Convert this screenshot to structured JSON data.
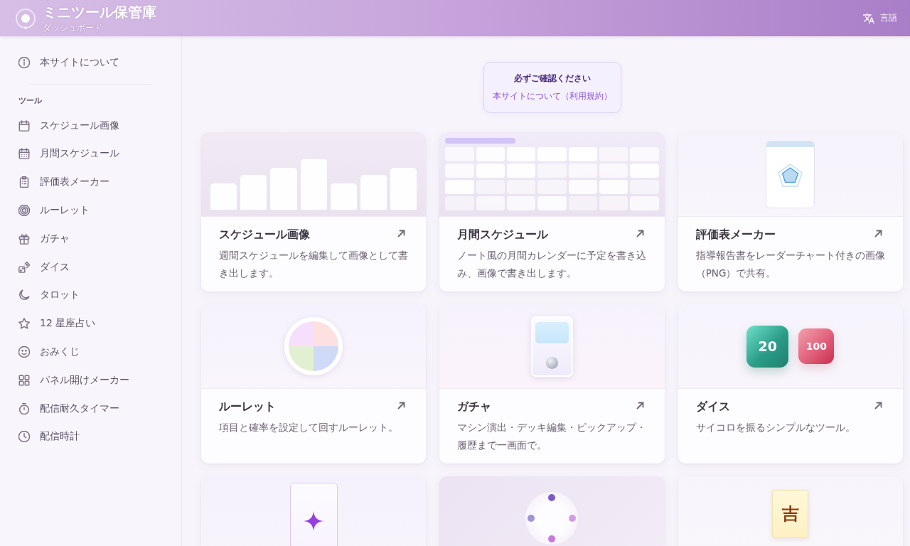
{
  "header": {
    "title": "ミニツール保管庫",
    "subtitle": "ダッシュボード",
    "language_button": "言語"
  },
  "sidebar": {
    "about_item": {
      "kind": "info",
      "label": "本サイトについて",
      "selected": false
    },
    "section_label": "ツール",
    "items": [
      {
        "kind": "calendar",
        "label": "スケジュール画像",
        "selected": false
      },
      {
        "kind": "calendar-grid",
        "label": "月間スケジュール",
        "selected": false
      },
      {
        "kind": "clipboard",
        "label": "評価表メーカー",
        "selected": false
      },
      {
        "kind": "target",
        "label": "ルーレット",
        "selected": false
      },
      {
        "kind": "gift",
        "label": "ガチャ",
        "selected": false
      },
      {
        "kind": "dice",
        "label": "ダイス",
        "selected": false
      },
      {
        "kind": "moon",
        "label": "タロット",
        "selected": false
      },
      {
        "kind": "star",
        "label": "12 星座占い",
        "selected": false
      },
      {
        "kind": "smile",
        "label": "おみくじ",
        "selected": false
      },
      {
        "kind": "grid",
        "label": "パネル開けメーカー",
        "selected": false
      },
      {
        "kind": "stopwatch",
        "label": "配信耐久タイマー",
        "selected": false
      },
      {
        "kind": "clock",
        "label": "配信時計",
        "selected": false
      }
    ]
  },
  "notice": {
    "title": "必ずご確認ください",
    "link": "本サイトについて（利用規約）"
  },
  "cards": [
    {
      "kind": "bars",
      "title": "スケジュール画像",
      "description": "週間スケジュールを編集して画像として書き出します。"
    },
    {
      "kind": "calendar",
      "title": "月間スケジュール",
      "description": "ノート風の月間カレンダーに予定を書き込み、画像で書き出します。"
    },
    {
      "kind": "radar",
      "title": "評価表メーカー",
      "description": "指導報告書をレーダーチャート付きの画像（PNG）で共有。"
    },
    {
      "kind": "roulette",
      "title": "ルーレット",
      "description": "項目と確率を設定して回すルーレット。"
    },
    {
      "kind": "gacha",
      "title": "ガチャ",
      "description": "マシン演出・デッキ編集・ピックアップ・履歴まで一画面で。"
    },
    {
      "kind": "dice",
      "dice": [
        "20",
        "100"
      ],
      "title": "ダイス",
      "description": "サイコロを振るシンプルなツール。"
    },
    {
      "kind": "tarot"
    },
    {
      "kind": "horoscope"
    },
    {
      "kind": "omikuji",
      "fortune": "吉"
    }
  ]
}
